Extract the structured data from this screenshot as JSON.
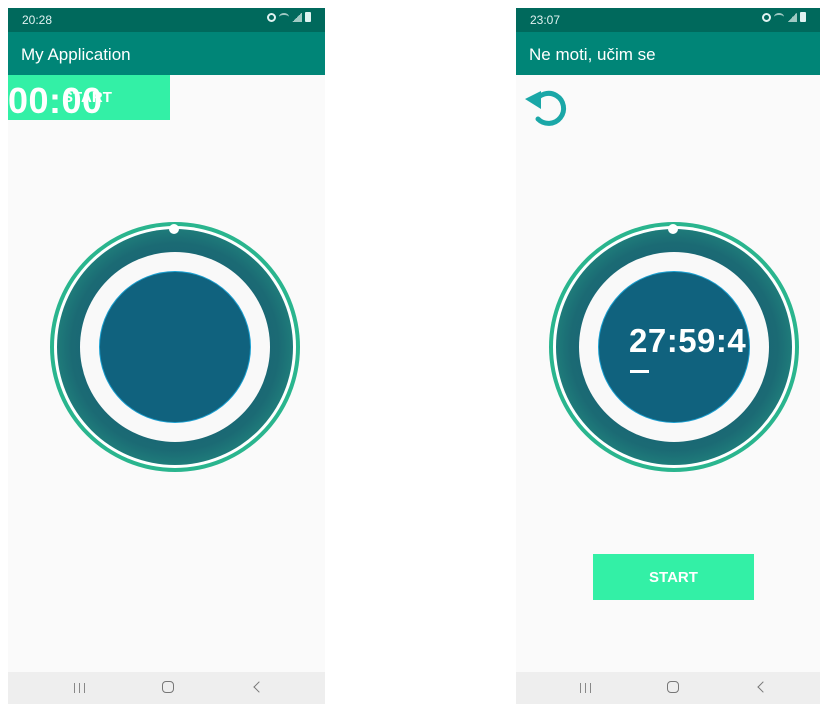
{
  "left_screen": {
    "status_time": "20:28",
    "app_title": "My Application",
    "start_label": "START",
    "timer": "00:00"
  },
  "right_screen": {
    "status_time": "23:07",
    "app_title": "Ne moti, učim se",
    "timer": "27:59:4",
    "start_label": "START"
  },
  "colors": {
    "app_bar": "#008577",
    "status_bar": "#00695c",
    "start_button": "#33f0a6",
    "dial_ring": "#2ab58e",
    "dial_center": "#10627e",
    "reset_icon": "#1aa7a7"
  },
  "icons": [
    "alarm-icon",
    "wifi-icon",
    "signal-icon",
    "battery-icon",
    "reset-icon",
    "nav-recents-icon",
    "nav-home-icon",
    "nav-back-icon"
  ]
}
